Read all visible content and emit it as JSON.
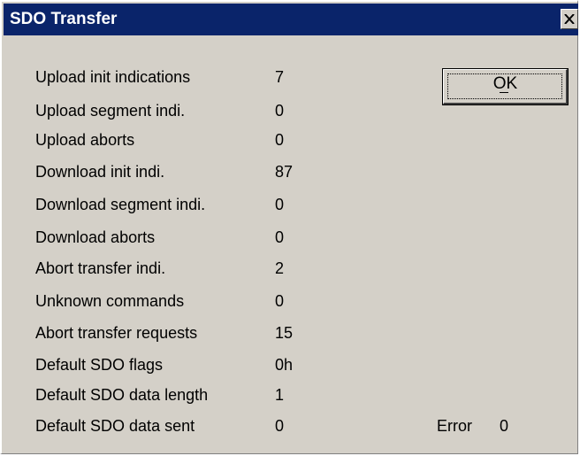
{
  "window": {
    "title": "SDO Transfer",
    "close_icon": "close-x-icon"
  },
  "stats": [
    {
      "label": "Upload init indications",
      "value": "7"
    },
    {
      "label": "Upload segment indi.",
      "value": "0"
    },
    {
      "label": "Upload aborts",
      "value": "0"
    },
    {
      "label": "Download init indi.",
      "value": "87"
    },
    {
      "label": "Download segment indi.",
      "value": "0"
    },
    {
      "label": "Download aborts",
      "value": "0"
    },
    {
      "label": "Abort transfer indi.",
      "value": "2"
    },
    {
      "label": "Unknown commands",
      "value": "0"
    },
    {
      "label": "Abort transfer requests",
      "value": "15"
    },
    {
      "label": "Default SDO flags",
      "value": "0h"
    },
    {
      "label": "Default SDO data length",
      "value": "1"
    },
    {
      "label": "Default SDO data sent",
      "value": "0"
    }
  ],
  "error": {
    "label": "Error",
    "value": "0"
  },
  "buttons": {
    "ok_label": "OK"
  },
  "colors": {
    "titlebar": "#0a246a",
    "face": "#d4d0c8",
    "title_text": "#ffffff"
  }
}
